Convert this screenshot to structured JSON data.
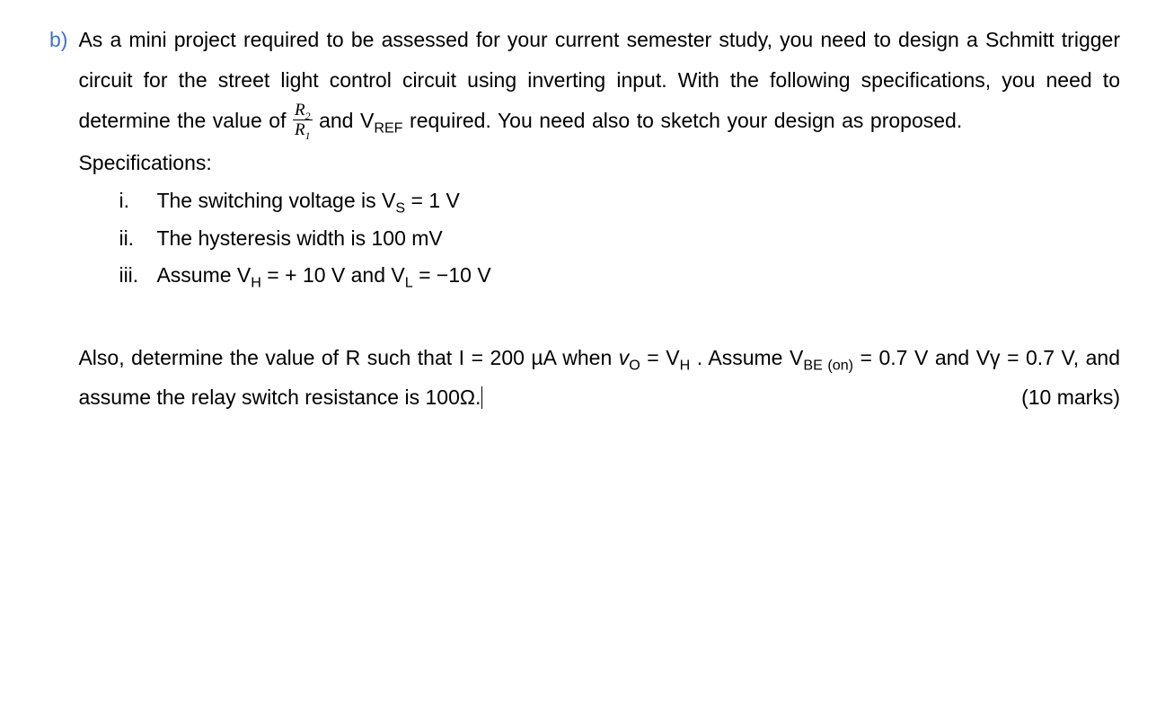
{
  "question": {
    "label": "b)",
    "main_text_1": "As a mini project required to be assessed for your current semester study, you need to design a Schmitt trigger circuit for the street light control circuit using inverting input. With the following specifications, you need to determine the value of ",
    "fraction_num": "R",
    "fraction_num_sub": "2",
    "fraction_den": "R",
    "fraction_den_sub": "1",
    "main_text_2": " and V",
    "main_text_2_sub": "REF",
    "main_text_3": " required. You need also to sketch your design as proposed.",
    "specs_header": "Specifications:",
    "specs": [
      {
        "num": "i.",
        "pre": "The switching voltage is V",
        "sub": "S",
        "post": " = 1 V"
      },
      {
        "num": "ii.",
        "pre": "The hysteresis width is 100 mV",
        "sub": "",
        "post": ""
      },
      {
        "num": "iii.",
        "pre": "Assume V",
        "sub": "H",
        "mid": " = + 10 V and V",
        "sub2": "L",
        "post": " = −10 V"
      }
    ],
    "para2_1": "Also, determine the value of R such that I = 200 µA when ",
    "para2_vo": "v",
    "para2_vo_sub": "O",
    "para2_2": " = V",
    "para2_vh_sub": "H",
    "para2_3": " . Assume V",
    "para2_be_sub": "BE (on)",
    "para2_4": " = 0.7 V and Vγ = 0.7 V, and assume the relay switch resistance is 100Ω.",
    "marks": "(10 marks)"
  }
}
